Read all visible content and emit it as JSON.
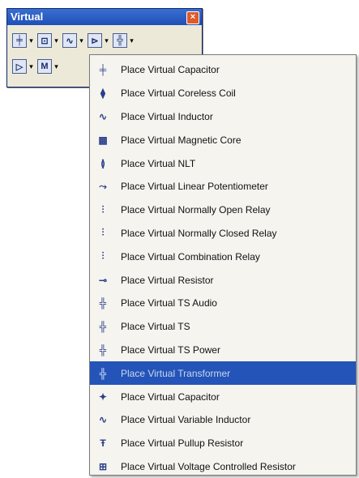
{
  "toolbar": {
    "title": "Virtual",
    "close_glyph": "×",
    "row1": [
      {
        "icon": "capacitor-icon",
        "glyph": "╪"
      },
      {
        "icon": "coil-icon",
        "glyph": "⊡"
      },
      {
        "icon": "inductor-icon",
        "glyph": "∿"
      },
      {
        "icon": "relay-icon",
        "glyph": "⊳"
      },
      {
        "icon": "transformer-icon",
        "glyph": "╬"
      }
    ],
    "row2": [
      {
        "icon": "opamp-icon",
        "glyph": "▷"
      },
      {
        "icon": "meter-icon",
        "glyph": "M"
      }
    ],
    "dropdown_glyph": "▾"
  },
  "menu": {
    "items": [
      {
        "label": "Place Virtual Capacitor",
        "icon": "capacitor-icon",
        "glyph": "╪"
      },
      {
        "label": "Place Virtual Coreless Coil",
        "icon": "coil-icon",
        "glyph": "⧫"
      },
      {
        "label": "Place Virtual Inductor",
        "icon": "inductor-icon",
        "glyph": "∿"
      },
      {
        "label": "Place Virtual Magnetic Core",
        "icon": "magnetic-core-icon",
        "glyph": "▦"
      },
      {
        "label": "Place Virtual NLT",
        "icon": "nlt-icon",
        "glyph": "≬"
      },
      {
        "label": "Place Virtual Linear Potentiometer",
        "icon": "potentiometer-icon",
        "glyph": "⤳"
      },
      {
        "label": "Place Virtual Normally Open Relay",
        "icon": "relay-no-icon",
        "glyph": "⫶"
      },
      {
        "label": "Place Virtual Normally Closed Relay",
        "icon": "relay-nc-icon",
        "glyph": "⫶"
      },
      {
        "label": "Place Virtual Combination Relay",
        "icon": "relay-combo-icon",
        "glyph": "⫶"
      },
      {
        "label": "Place Virtual Resistor",
        "icon": "resistor-icon",
        "glyph": "⊸"
      },
      {
        "label": "Place Virtual TS Audio",
        "icon": "ts-audio-icon",
        "glyph": "╬"
      },
      {
        "label": "Place Virtual TS",
        "icon": "ts-icon",
        "glyph": "╬"
      },
      {
        "label": "Place Virtual TS Power",
        "icon": "ts-power-icon",
        "glyph": "╬"
      },
      {
        "label": "Place Virtual Transformer",
        "icon": "transformer-icon",
        "glyph": "╬",
        "selected": true
      },
      {
        "label": "Place Virtual Capacitor",
        "icon": "variable-capacitor-icon",
        "glyph": "✦"
      },
      {
        "label": "Place Virtual Variable Inductor",
        "icon": "variable-inductor-icon",
        "glyph": "∿"
      },
      {
        "label": "Place Virtual Pullup Resistor",
        "icon": "pullup-resistor-icon",
        "glyph": "Ŧ"
      },
      {
        "label": "Place Virtual Voltage Controlled Resistor",
        "icon": "vcr-icon",
        "glyph": "⊞"
      }
    ]
  }
}
